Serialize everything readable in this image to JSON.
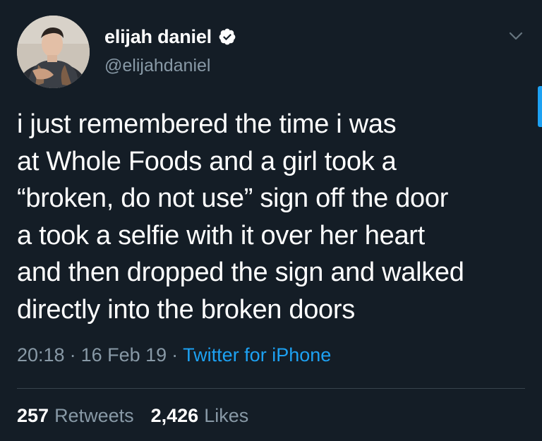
{
  "author": {
    "display_name": "elijah daniel",
    "handle": "@elijahdaniel",
    "verified": true
  },
  "tweet": {
    "lines": [
      "i just remembered the time i was",
      "at Whole Foods and a girl took a",
      "“broken, do not use” sign off the door",
      "a took a selfie with it over her heart",
      "and then dropped the sign and walked",
      "directly into the broken doors"
    ],
    "time": "20:18",
    "date": "16 Feb 19",
    "separator": "·",
    "source": "Twitter for iPhone"
  },
  "stats": {
    "retweets_count": "257",
    "retweets_label": "Retweets",
    "likes_count": "2,426",
    "likes_label": "Likes"
  },
  "colors": {
    "background": "#141d26",
    "text": "#ffffff",
    "secondary": "#8899a6",
    "accent": "#1da1f2",
    "divider": "#38444d"
  },
  "icons": {
    "verified": "verified-badge-icon",
    "caret": "chevron-down-icon"
  }
}
